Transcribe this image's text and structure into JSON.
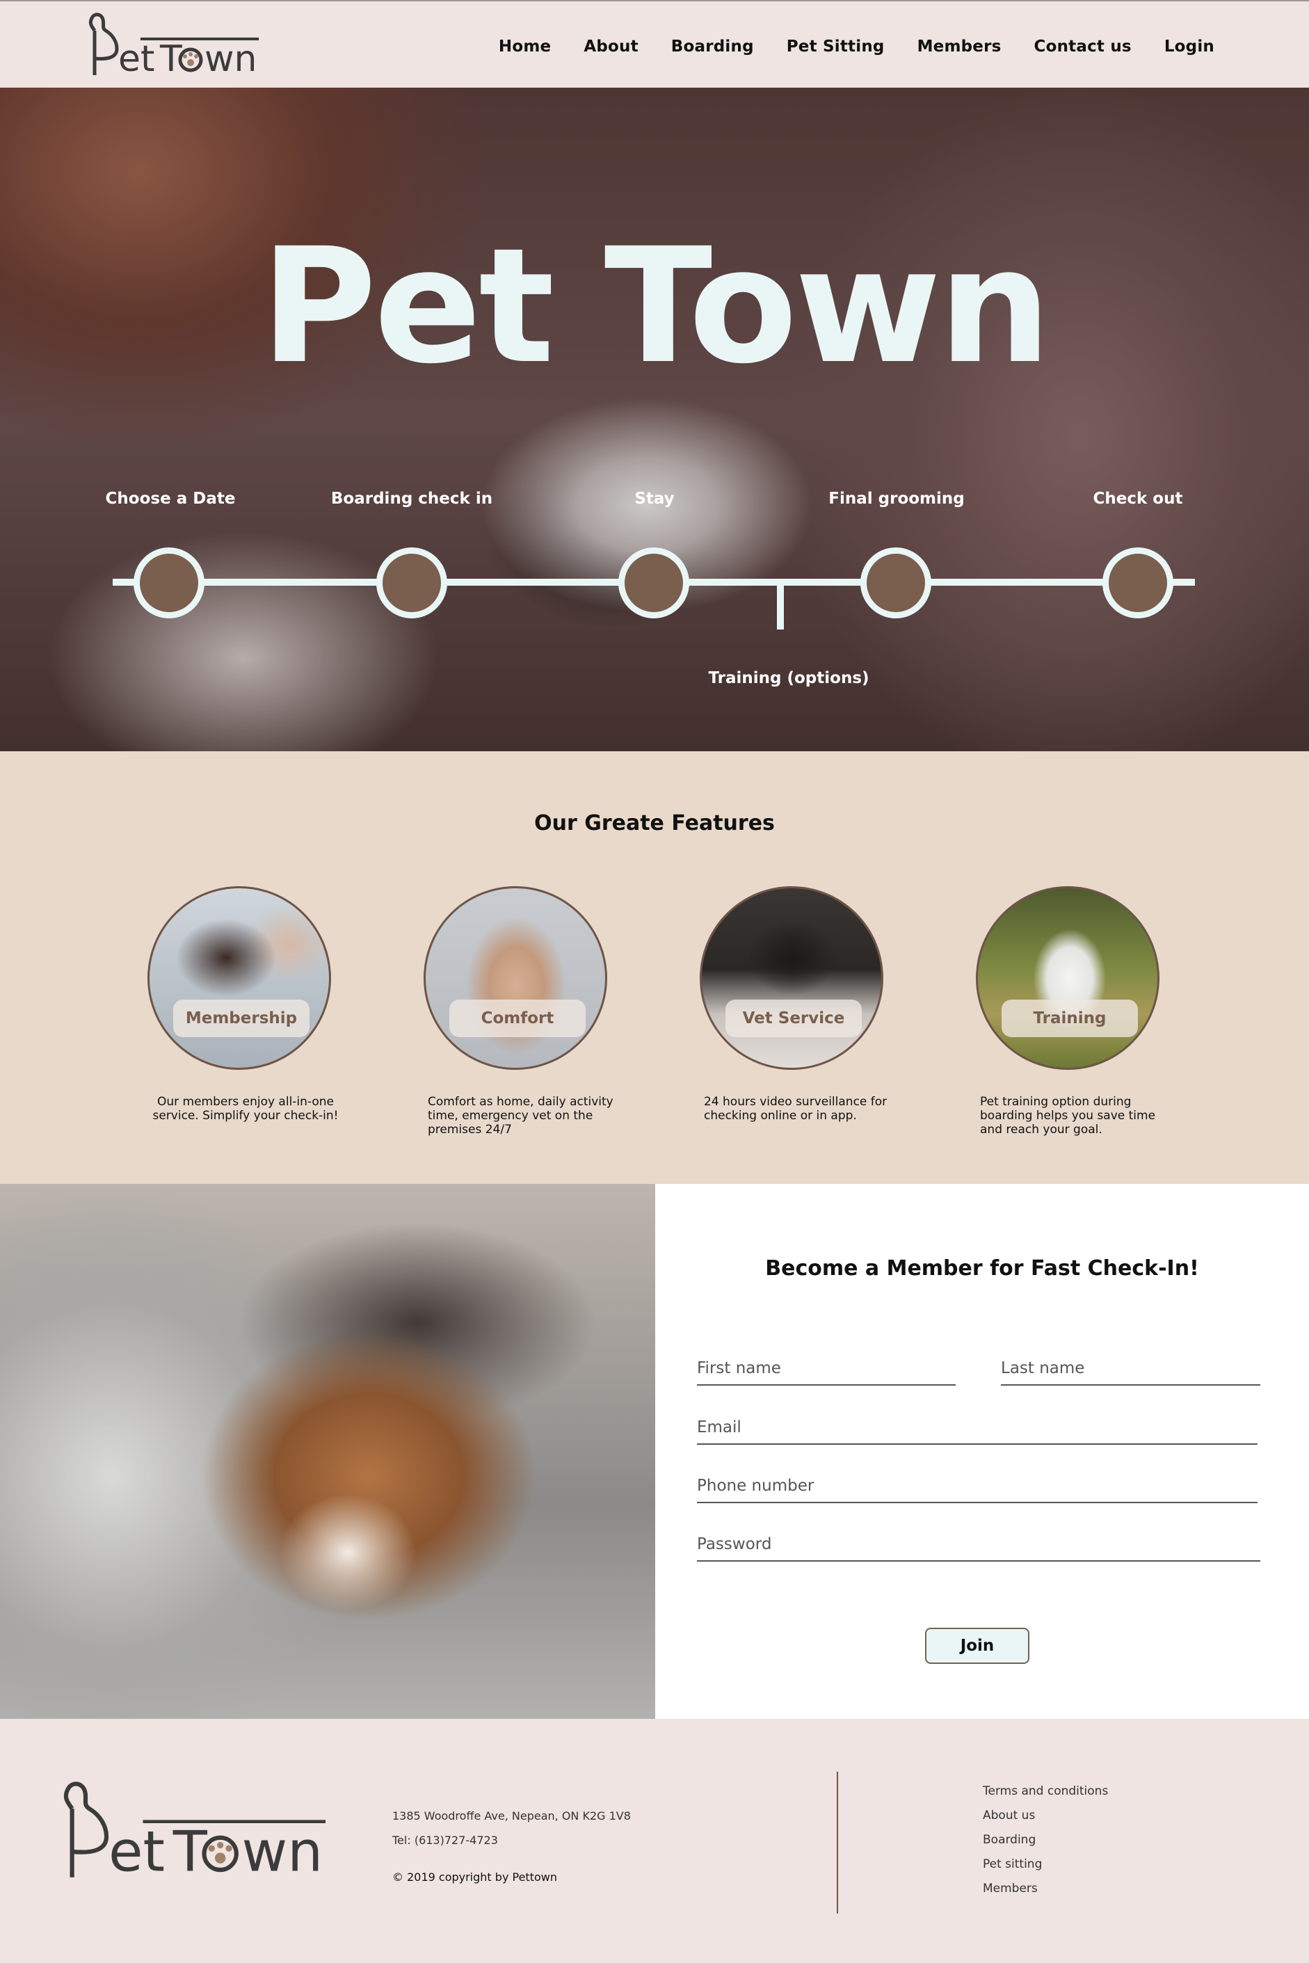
{
  "brand": {
    "logo_text": "PetTown",
    "colors": {
      "accent": "#7a5f4e",
      "light": "#eaf6f6",
      "header_bg": "#efe4e1",
      "features_bg": "#e8d9cb"
    }
  },
  "nav": {
    "items": [
      "Home",
      "About",
      "Boarding",
      "Pet Sitting",
      "Members",
      "Contact us",
      "Login"
    ]
  },
  "hero": {
    "title": "Pet Town",
    "steps": [
      "Choose a Date",
      "Boarding check in",
      "Stay",
      "Final grooming",
      "Check out"
    ],
    "branch_label": "Training (options)"
  },
  "features": {
    "heading": "Our Greate Features",
    "items": [
      {
        "tag": "Membership",
        "desc": "Our members enjoy all-in-one service. Simplify your check-in!"
      },
      {
        "tag": "Comfort",
        "desc": "Comfort as home, daily activity time, emergency vet on the premises 24/7"
      },
      {
        "tag": "Vet Service",
        "desc": "24 hours video surveillance for checking online or in app."
      },
      {
        "tag": "Training",
        "desc": "Pet training option during boarding helps you save time and reach your goal."
      }
    ]
  },
  "member": {
    "heading": "Become a Member for Fast Check-In!",
    "first_name_placeholder": "First name",
    "last_name_placeholder": "Last name",
    "email_placeholder": "Email",
    "phone_placeholder": "Phone number",
    "password_placeholder": "Password",
    "join_label": "Join"
  },
  "footer": {
    "address": "1385 Woodroffe Ave, Nepean, ON K2G 1V8",
    "phone": "Tel: (613)727-4723",
    "copyright": "© 2019 copyright by Pettown",
    "links": [
      "Terms and conditions",
      "About us",
      "Boarding",
      "Pet sitting",
      "Members"
    ]
  }
}
